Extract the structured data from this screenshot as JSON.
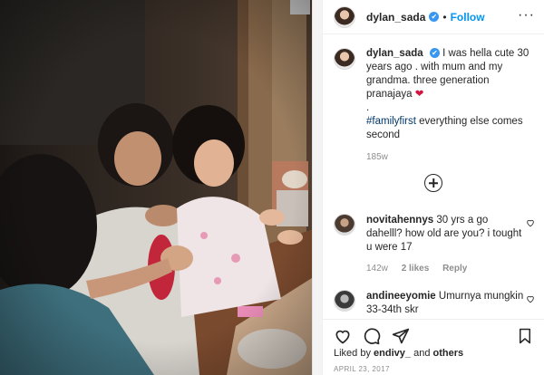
{
  "post": {
    "username": "dylan_sada",
    "verified_mark": "✔",
    "follow_label": "Follow",
    "more_icon": "more-options-icon",
    "caption_main": "I was hella cute 30 years ago . with mum and my grandma. three generation pranajaya",
    "caption_emoji": "❤",
    "caption_dot": ".",
    "caption_hashtag": "#familyfirst",
    "caption_tail": "everything else comes second",
    "caption_time": "185w",
    "load_more_icon": "plus-circle-icon"
  },
  "comments": [
    {
      "username": "novitahennys",
      "text": "30 yrs a go dahelll? how old are you? i tought u were 17",
      "time": "142w",
      "likes": "2 likes",
      "reply": "Reply"
    },
    {
      "username": "andineeyomie",
      "text": "Umurnya mungkin 33-34th skr"
    }
  ],
  "actions": {
    "icons": [
      "heart-icon",
      "comment-icon",
      "share-icon",
      "bookmark-icon"
    ]
  },
  "likes": {
    "prefix": "Liked by",
    "user": "endivy_",
    "joiner": "and",
    "others": "others"
  },
  "date": "APRIL 23, 2017",
  "colors": {
    "accent": "#0095f6",
    "verified": "#3897f0",
    "heart": "#d1173f",
    "hashtag": "#00376b",
    "muted": "#8e8e8e"
  }
}
